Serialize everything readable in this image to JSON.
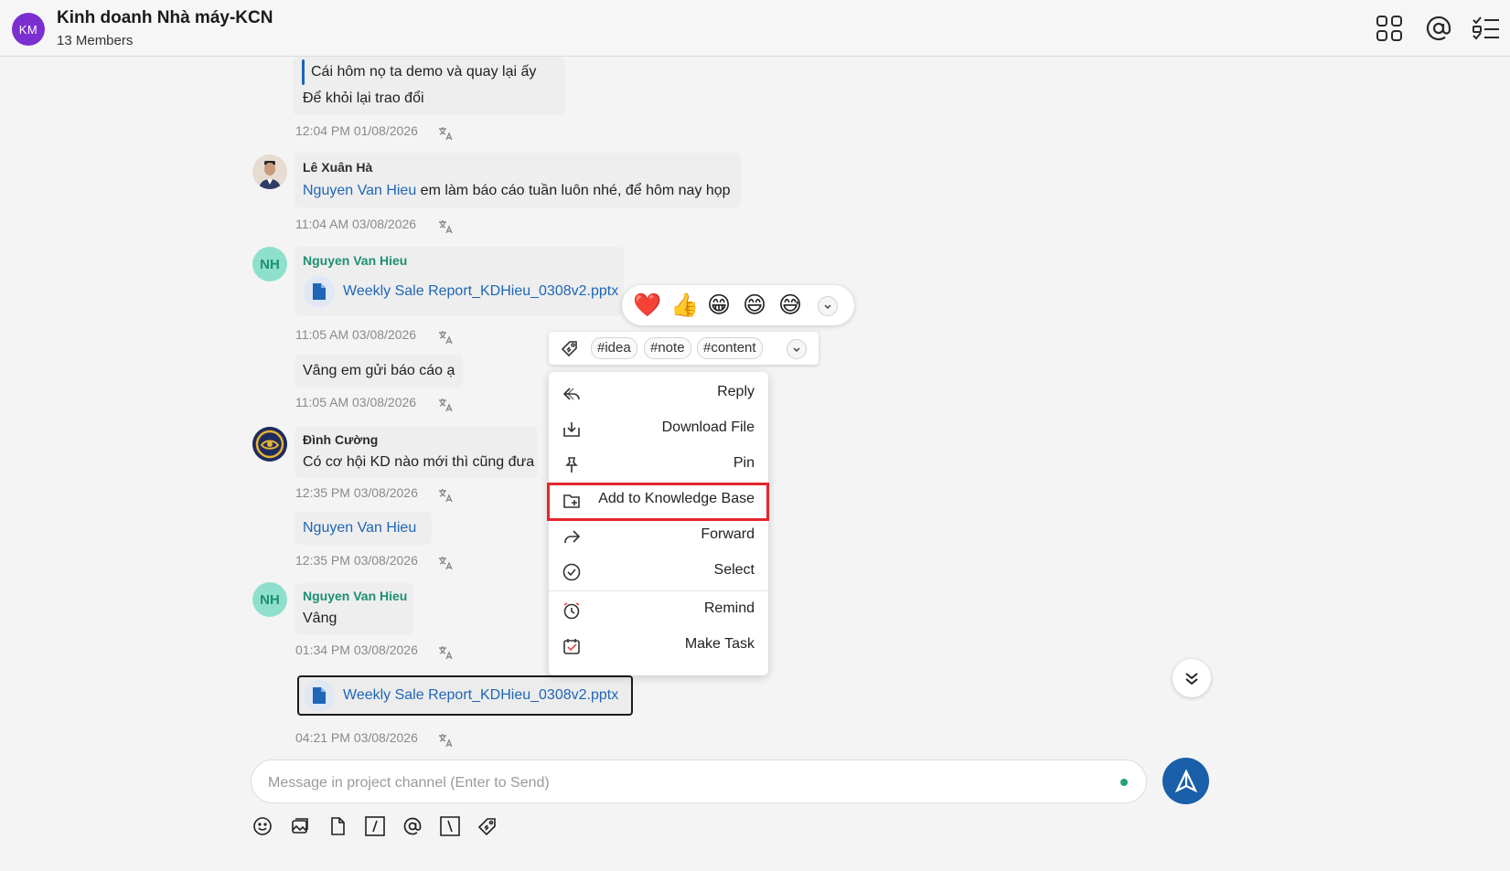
{
  "header": {
    "avatar_initials": "KM",
    "title": "Kinh doanh Nhà máy-KCN",
    "subtitle": "13 Members",
    "icons": [
      "apps-grid-icon",
      "mention-icon",
      "task-list-icon"
    ]
  },
  "messages": {
    "m1": {
      "quote": "Cái hôm nọ ta demo và quay lại ấy",
      "text": "Để khỏi lại trao đổi",
      "time": "12:04 PM 01/08/2026"
    },
    "m2": {
      "sender": "Lê Xuân Hà",
      "mention": "Nguyen Van Hieu",
      "text": " em làm báo cáo tuần luôn nhé, để hôm nay họp",
      "time": "11:04 AM 03/08/2026"
    },
    "m3": {
      "avatar": "NH",
      "sender": "Nguyen Van Hieu",
      "file": "Weekly Sale Report_KDHieu_0308v2.pptx",
      "time": "11:05 AM 03/08/2026"
    },
    "m4": {
      "text": "Vâng em gửi báo cáo ạ",
      "time": "11:05 AM 03/08/2026"
    },
    "m5": {
      "sender": "Đình Cường",
      "text": "Có cơ hội KD nào mới thì cũng đưa",
      "time": "12:35 PM 03/08/2026"
    },
    "m6": {
      "mention": "Nguyen Van Hieu",
      "time": "12:35 PM 03/08/2026"
    },
    "m7": {
      "avatar": "NH",
      "sender": "Nguyen Van Hieu",
      "text": "Vâng",
      "time": "01:34 PM 03/08/2026"
    },
    "m8": {
      "file": "Weekly Sale Report_KDHieu_0308v2.pptx",
      "time": "04:21 PM 03/08/2026"
    }
  },
  "reactions": [
    "❤️",
    "👍",
    "😁",
    "😄",
    "😅"
  ],
  "tags": [
    "#idea",
    "#note",
    "#content"
  ],
  "context_menu": {
    "reply": "Reply",
    "download": "Download File",
    "pin": "Pin",
    "add_kb": "Add to Knowledge Base",
    "forward": "Forward",
    "select": "Select",
    "remind": "Remind",
    "make_task": "Make Task"
  },
  "composer": {
    "placeholder": "Message in project channel (Enter to Send)",
    "tools": [
      "emoji-icon",
      "image-icon",
      "file-icon",
      "slash-command-icon",
      "mention-icon",
      "backslash-icon",
      "tag-icon"
    ]
  },
  "colors": {
    "accent": "#1f66b7",
    "send_button": "#1a5faa",
    "highlight": "#e3262b",
    "avatar_purple": "#7b2fd1",
    "avatar_green": "#8ee0cd"
  }
}
